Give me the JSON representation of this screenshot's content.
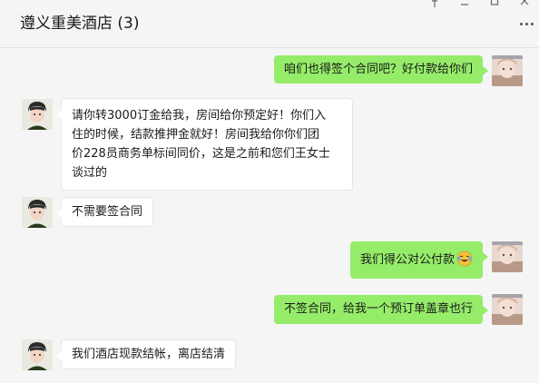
{
  "header": {
    "title": "遵义重美酒店 (3)"
  },
  "window_controls": [
    "pin-icon",
    "minimize-icon",
    "maximize-icon",
    "close-icon"
  ],
  "colors": {
    "outgoing_bubble": "#95ec69",
    "incoming_bubble": "#ffffff",
    "background": "#f5f5f5"
  },
  "messages": [
    {
      "side": "out",
      "text": "咱们也得签个合同吧？好付款给你们"
    },
    {
      "side": "in",
      "lines": [
        "请你转3000订金给我，房间给你预定好！你们入",
        "住的时候，结款推押金就好！房间我给你你们团",
        "价228员商务单标间同价，这是之前和您们王女士",
        "谈过的"
      ]
    },
    {
      "side": "in",
      "text": "不需要签合同"
    },
    {
      "side": "out",
      "text": "我们得公对公付款",
      "emoji": "crying-laughing-emoji"
    },
    {
      "side": "out",
      "text": "不签合同，给我一个预订单盖章也行"
    },
    {
      "side": "in",
      "text": "我们酒店现款结帐，离店结清"
    }
  ]
}
